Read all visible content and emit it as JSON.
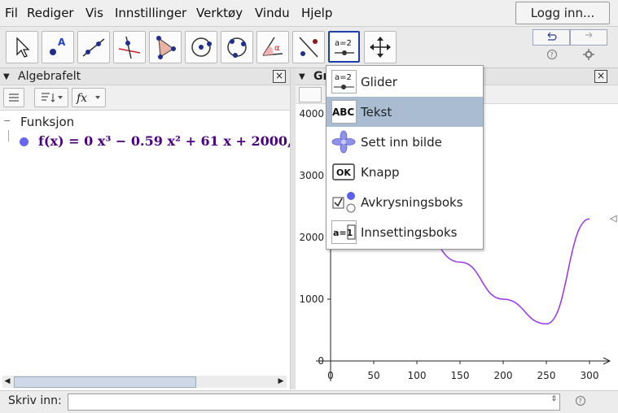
{
  "menubar": {
    "items": [
      "Fil",
      "Rediger",
      "Vis",
      "Innstillinger",
      "Verktøy",
      "Vindu",
      "Hjelp"
    ],
    "login_label": "Logg inn..."
  },
  "toolbar": {
    "tools": [
      "move-tool",
      "point-tool",
      "line-tool",
      "perpendicular-tool",
      "polygon-tool",
      "circle-tool",
      "conic-tool",
      "angle-tool",
      "reflect-tool",
      "slider-tool",
      "move-view-tool"
    ],
    "selected": "slider-tool",
    "selected_icon_text": "a=2"
  },
  "algebra": {
    "title": "Algebrafelt",
    "category": "Funksjon",
    "function_text": "f(x)  =  0 x³ − 0.59 x² + 61 x + 2000,",
    "fx_label": "f",
    "function_color": "#6666ee"
  },
  "graphics": {
    "title": "Gr",
    "curve_color": "#9933ee"
  },
  "dropdown": {
    "items": [
      {
        "label": "Glider",
        "icon": "slider-icon",
        "icon_text": "a=2"
      },
      {
        "label": "Tekst",
        "icon": "text-icon",
        "icon_text": "ABC"
      },
      {
        "label": "Sett inn bilde",
        "icon": "image-icon",
        "icon_text": ""
      },
      {
        "label": "Knapp",
        "icon": "button-icon",
        "icon_text": "OK"
      },
      {
        "label": "Avkrysningsboks",
        "icon": "checkbox-icon",
        "icon_text": ""
      },
      {
        "label": "Innsettingsboks",
        "icon": "input-box-icon",
        "icon_text": "a=1"
      }
    ],
    "selected_index": 1
  },
  "chart_data": {
    "type": "line",
    "x": [
      0,
      50,
      100,
      150,
      200,
      250,
      300
    ],
    "y": [
      2000,
      2000,
      2150,
      1600,
      1000,
      600,
      2300
    ],
    "xticks": [
      "0",
      "50",
      "100",
      "150",
      "200",
      "250",
      "300"
    ],
    "yticks": [
      "0",
      "1000",
      "2000",
      "3000",
      "4000"
    ],
    "xlim": [
      -10,
      310
    ],
    "ylim": [
      -100,
      4100
    ]
  },
  "inputbar": {
    "label": "Skriv inn:",
    "value": ""
  }
}
